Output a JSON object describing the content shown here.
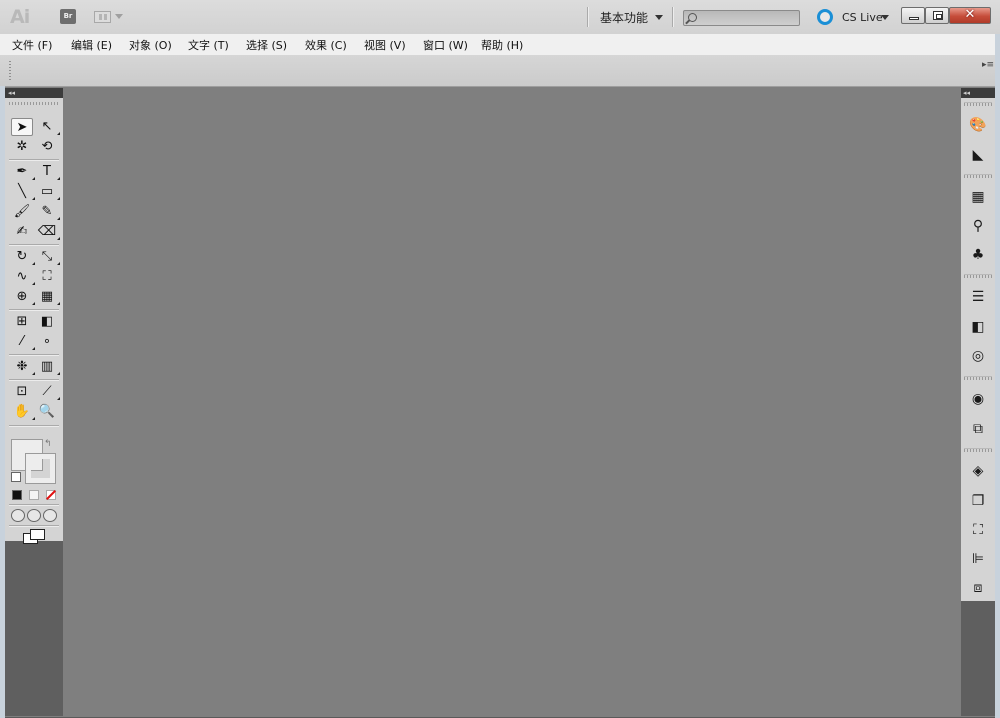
{
  "titlebar": {
    "app_logo": "Ai",
    "bridge_label": "Br",
    "workspace": "基本功能",
    "search_placeholder": "",
    "cs_live": "CS Live",
    "close_glyph": "✕"
  },
  "menubar": {
    "items": [
      {
        "label": "文件 (F)"
      },
      {
        "label": "编辑 (E)"
      },
      {
        "label": "对象 (O)"
      },
      {
        "label": "文字 (T)"
      },
      {
        "label": "选择 (S)"
      },
      {
        "label": "效果 (C)"
      },
      {
        "label": "视图 (V)"
      },
      {
        "label": "窗口 (W)"
      },
      {
        "label": "帮助 (H)"
      }
    ]
  },
  "controlbar": {
    "panel_menu_glyph": "▸≡"
  },
  "toolbar": {
    "collapse_glyph": "◂◂",
    "tools": [
      {
        "name": "selection-tool",
        "glyph": "➤"
      },
      {
        "name": "direct-selection-tool",
        "glyph": "↖"
      },
      {
        "name": "magic-wand-tool",
        "glyph": "✲"
      },
      {
        "name": "lasso-tool",
        "glyph": "⟲"
      },
      {
        "name": "pen-tool",
        "glyph": "✒"
      },
      {
        "name": "type-tool",
        "glyph": "T"
      },
      {
        "name": "line-segment-tool",
        "glyph": "╲"
      },
      {
        "name": "rectangle-tool",
        "glyph": "▭"
      },
      {
        "name": "paintbrush-tool",
        "glyph": "🖌"
      },
      {
        "name": "pencil-tool",
        "glyph": "✎"
      },
      {
        "name": "blob-brush-tool",
        "glyph": "✍"
      },
      {
        "name": "eraser-tool",
        "glyph": "⌫"
      },
      {
        "name": "rotate-tool",
        "glyph": "↻"
      },
      {
        "name": "scale-tool",
        "glyph": "⤡"
      },
      {
        "name": "warp-tool",
        "glyph": "∿"
      },
      {
        "name": "free-transform-tool",
        "glyph": "⛶"
      },
      {
        "name": "shape-builder-tool",
        "glyph": "⊕"
      },
      {
        "name": "perspective-grid-tool",
        "glyph": "▦"
      },
      {
        "name": "mesh-tool",
        "glyph": "⊞"
      },
      {
        "name": "gradient-tool",
        "glyph": "◧"
      },
      {
        "name": "eyedropper-tool",
        "glyph": "⁄"
      },
      {
        "name": "blend-tool",
        "glyph": "∘"
      },
      {
        "name": "symbol-sprayer-tool",
        "glyph": "❉"
      },
      {
        "name": "column-graph-tool",
        "glyph": "▥"
      },
      {
        "name": "artboard-tool",
        "glyph": "⊡"
      },
      {
        "name": "slice-tool",
        "glyph": "⟋"
      },
      {
        "name": "hand-tool",
        "glyph": "✋"
      },
      {
        "name": "zoom-tool",
        "glyph": "🔍"
      }
    ],
    "swap_glyph": "↰"
  },
  "rightdock": {
    "collapse_glyph": "◂◂",
    "icons": [
      "color-panel-icon",
      "color-guide-icon",
      "swatches-icon",
      "brushes-icon",
      "symbols-icon",
      "stroke-icon",
      "gradient-icon",
      "transparency-icon",
      "appearance-icon",
      "graphic-styles-icon",
      "layers-icon",
      "artboards-icon",
      "transform-icon",
      "align-icon",
      "pathfinder-icon"
    ],
    "glyphs": [
      "🎨",
      "◣",
      "▦",
      "⚲",
      "♣",
      "☰",
      "◧",
      "◎",
      "◉",
      "⧉",
      "◈",
      "❐",
      "⛶",
      "⊫",
      "⧈"
    ]
  }
}
